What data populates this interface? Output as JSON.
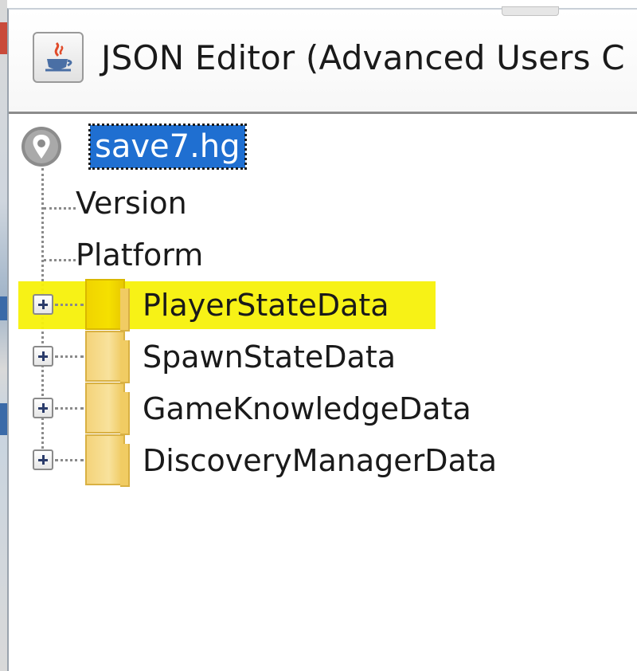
{
  "window": {
    "title": "JSON Editor (Advanced Users C"
  },
  "tree": {
    "root": {
      "label": "save7.hg",
      "icon": "map-pin-icon",
      "selected": true
    },
    "leaves": [
      {
        "label": "Version"
      },
      {
        "label": "Platform"
      }
    ],
    "nodes": [
      {
        "label": "PlayerStateData",
        "expanded": false,
        "highlighted": true,
        "icon": "folder-icon"
      },
      {
        "label": "SpawnStateData",
        "expanded": false,
        "highlighted": false,
        "icon": "folder-icon"
      },
      {
        "label": "GameKnowledgeData",
        "expanded": false,
        "highlighted": false,
        "icon": "folder-icon"
      },
      {
        "label": "DiscoveryManagerData",
        "expanded": false,
        "highlighted": false,
        "icon": "folder-icon"
      }
    ]
  },
  "colors": {
    "selection": "#1f6fd1",
    "highlight": "#f7f10a",
    "folder": "#f4d37a"
  }
}
